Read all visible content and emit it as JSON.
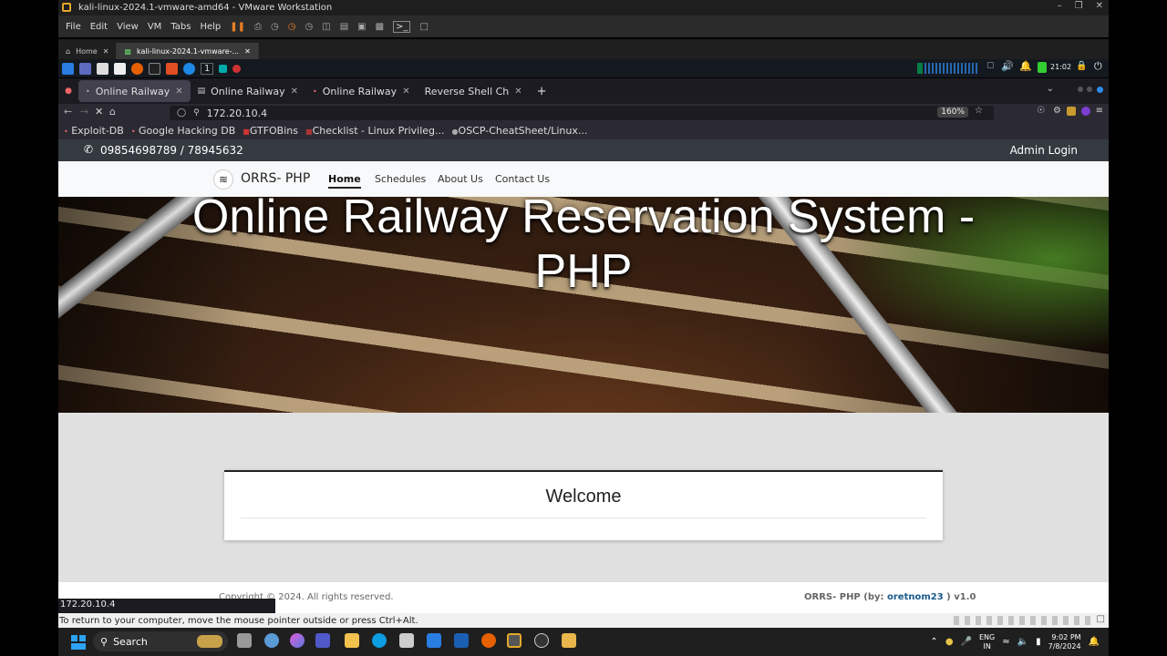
{
  "vmware": {
    "title": "kali-linux-2024.1-vmware-amd64 - VMware Workstation",
    "menu": [
      "File",
      "Edit",
      "View",
      "VM",
      "Tabs",
      "Help"
    ],
    "tabs": [
      {
        "label": "Home"
      },
      {
        "label": "kali-linux-2024.1-vmware-..."
      }
    ],
    "status_message": "To return to your computer, move the mouse pointer outside or press Ctrl+Alt."
  },
  "kali_panel": {
    "workspace_number": "1",
    "clock": "21:02"
  },
  "browser": {
    "tabs": [
      {
        "label": "Online Railway",
        "active": true
      },
      {
        "label": "Online Railway",
        "active": false
      },
      {
        "label": "Online Railway",
        "active": false
      },
      {
        "label": "Reverse Shell Ch",
        "active": false
      }
    ],
    "new_tab": "+",
    "url": "172.20.10.4",
    "zoom": "160%",
    "bookmarks": [
      "Exploit-DB",
      "Google Hacking DB",
      "GTFOBins",
      "Checklist - Linux Privileg...",
      "OSCP-CheatSheet/Linux..."
    ],
    "status_url": "172.20.10.4"
  },
  "site": {
    "phone": "09854698789 / 78945632",
    "admin_login": "Admin Login",
    "brand": "ORRS- PHP",
    "nav": [
      "Home",
      "Schedules",
      "About Us",
      "Contact Us"
    ],
    "hero_title": "Online Railway Reservation System - PHP",
    "welcome": "Welcome",
    "footer_copyright": "Copyright © 2024. All rights reserved.",
    "footer_credit_prefix": "ORRS- PHP (by: ",
    "footer_credit_author": "oretnom23",
    "footer_credit_suffix": " ) v1.0"
  },
  "taskbar": {
    "search": "Search",
    "lang_top": "ENG",
    "lang_bottom": "IN",
    "time": "9:02 PM",
    "date": "7/8/2024"
  }
}
